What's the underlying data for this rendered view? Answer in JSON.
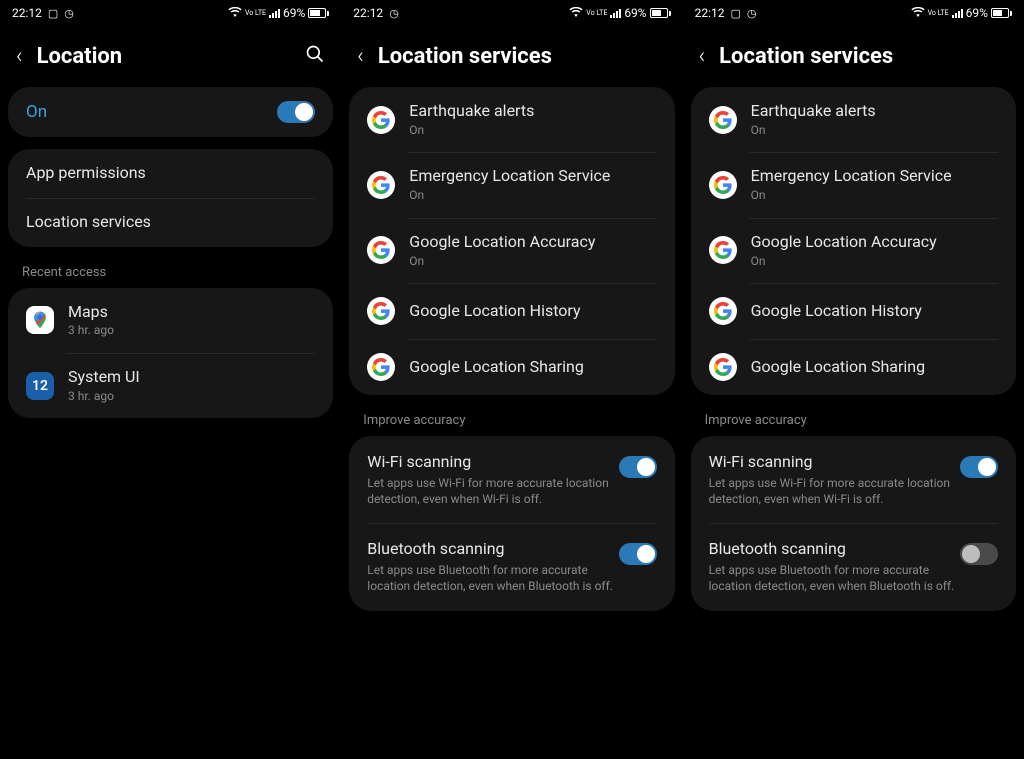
{
  "status": {
    "time": "22:12",
    "battery_pct": "69%",
    "lte_label": "Vo LTE"
  },
  "panel1": {
    "title": "Location",
    "on_label": "On",
    "on_state": true,
    "menu": {
      "app_permissions": "App permissions",
      "location_services": "Location services"
    },
    "recent_access_label": "Recent access",
    "recent": [
      {
        "name": "Maps",
        "sub": "3 hr. ago",
        "icon": "maps"
      },
      {
        "name": "System UI",
        "sub": "3 hr. ago",
        "icon": "systemui",
        "badge": "12"
      }
    ]
  },
  "services": {
    "title": "Location services",
    "items": [
      {
        "title": "Earthquake alerts",
        "sub": "On"
      },
      {
        "title": "Emergency Location Service",
        "sub": "On"
      },
      {
        "title": "Google Location Accuracy",
        "sub": "On"
      },
      {
        "title": "Google Location History",
        "sub": ""
      },
      {
        "title": "Google Location Sharing",
        "sub": ""
      }
    ],
    "improve_label": "Improve accuracy",
    "wifi": {
      "title": "Wi-Fi scanning",
      "desc": "Let apps use Wi-Fi for more accurate location detection, even when Wi-Fi is off."
    },
    "bt": {
      "title": "Bluetooth scanning",
      "desc": "Let apps use Bluetooth for more accurate location detection, even when Bluetooth is off."
    }
  },
  "panel2": {
    "wifi_on": true,
    "bt_on": true
  },
  "panel3": {
    "wifi_on": true,
    "bt_on": false
  }
}
